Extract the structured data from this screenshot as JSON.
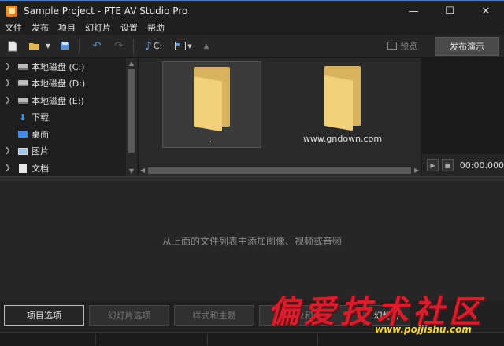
{
  "window": {
    "title": "Sample Project - PTE AV Studio Pro",
    "minimize": "—",
    "maximize": "☐",
    "close": "✕"
  },
  "menu": [
    "文件",
    "发布",
    "项目",
    "幻灯片",
    "设置",
    "帮助"
  ],
  "toolbar": {
    "drive": "C:",
    "preview_label": "预览",
    "publish_label": "发布演示"
  },
  "tree": {
    "items": [
      {
        "label": "本地磁盘 (C:)",
        "icon": "drive-icon",
        "expandable": true
      },
      {
        "label": "本地磁盘 (D:)",
        "icon": "drive-icon",
        "expandable": true
      },
      {
        "label": "本地磁盘 (E:)",
        "icon": "drive-icon",
        "expandable": true
      },
      {
        "label": "下载",
        "icon": "download-icon",
        "expandable": false
      },
      {
        "label": "桌面",
        "icon": "desktop-icon",
        "expandable": false
      },
      {
        "label": "图片",
        "icon": "pictures-icon",
        "expandable": true
      },
      {
        "label": "文档",
        "icon": "documents-icon",
        "expandable": true
      }
    ]
  },
  "files": [
    {
      "label": "..",
      "selected": true
    },
    {
      "label": "www.gndown.com",
      "selected": false
    }
  ],
  "player": {
    "time": "00:00.000"
  },
  "slides": {
    "hint": "从上面的文件列表中添加图像、视频或音频"
  },
  "bottom": {
    "project_options": "项目选项",
    "slide_options": "幻灯片选项",
    "styles_themes": "样式和主题",
    "objects": "对象和动画",
    "slide_show": "幻灯片"
  },
  "watermark": {
    "title": "偏爱技术社区",
    "url": "www.pojjishu.com"
  },
  "colors": {
    "accent": "#3a7fd0",
    "folder": "#f2cf7a",
    "watermark": "#d81e2c",
    "watermark_url": "#f5d23b"
  }
}
